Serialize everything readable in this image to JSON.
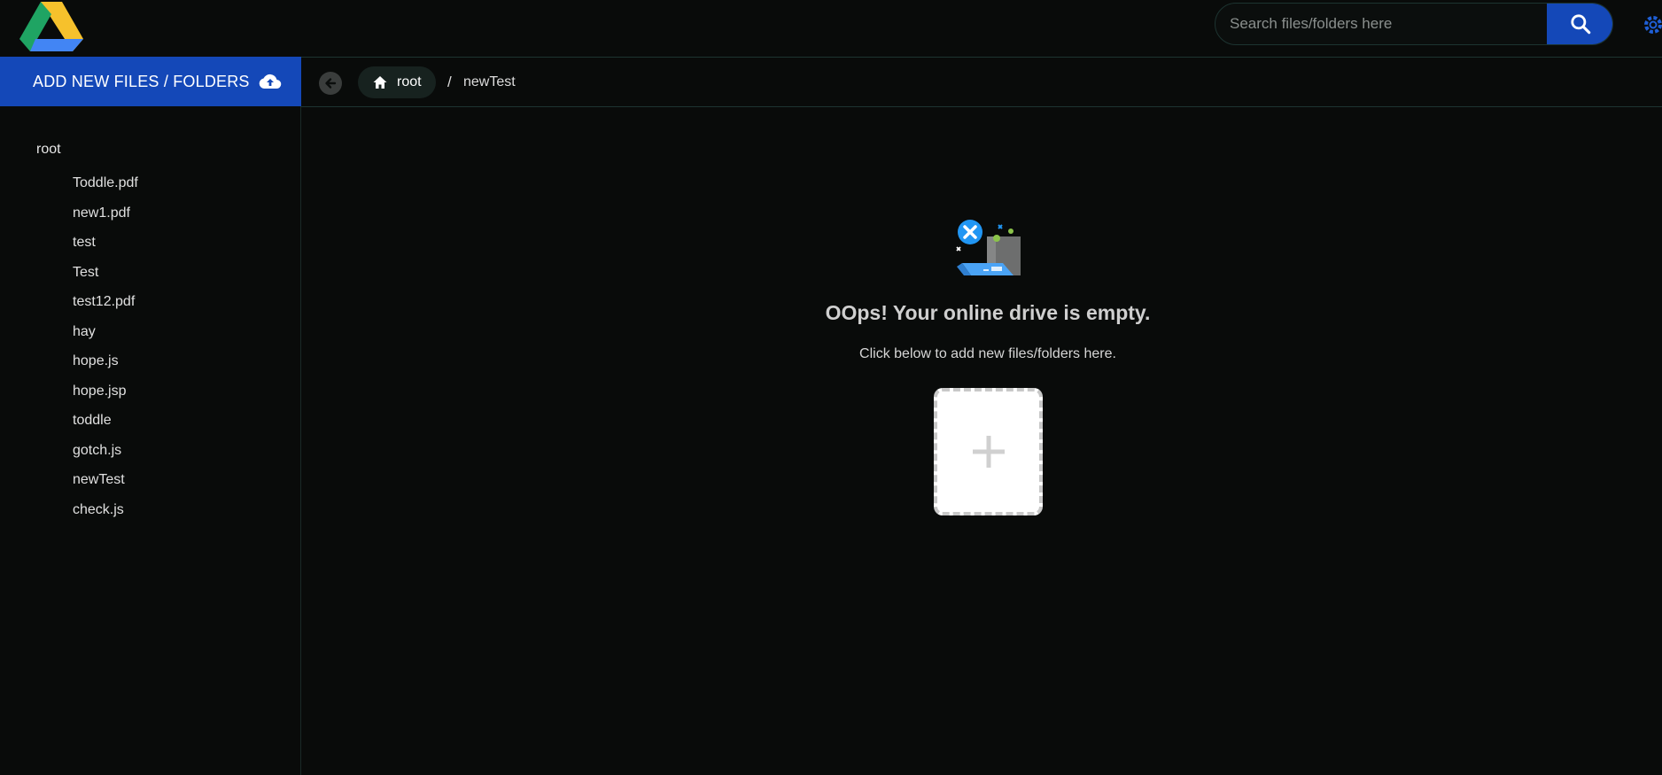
{
  "header": {
    "search": {
      "placeholder": "Search files/folders here",
      "value": ""
    }
  },
  "toolbar": {
    "add_label": "ADD NEW FILES / FOLDERS"
  },
  "sidebar": {
    "root_label": "root",
    "items": [
      "Toddle.pdf",
      "new1.pdf",
      "test",
      "Test",
      "test12.pdf",
      "hay",
      "hope.js",
      "hope.jsp",
      "toddle",
      "gotch.js",
      "newTest",
      "check.js"
    ]
  },
  "breadcrumb": {
    "root_label": "root",
    "separator": "/",
    "current": "newTest"
  },
  "empty_state": {
    "title": "OOps! Your online drive is empty.",
    "subtitle": "Click below to add new files/folders here."
  },
  "colors": {
    "accent": "#1448b8",
    "background": "#090b0a",
    "border": "#1d3431"
  },
  "icons": [
    "drive-logo-icon",
    "search-icon",
    "settings-gear-icon",
    "cloud-upload-icon",
    "back-arrow-icon",
    "home-icon",
    "empty-drive-illustration-icon",
    "plus-icon"
  ]
}
